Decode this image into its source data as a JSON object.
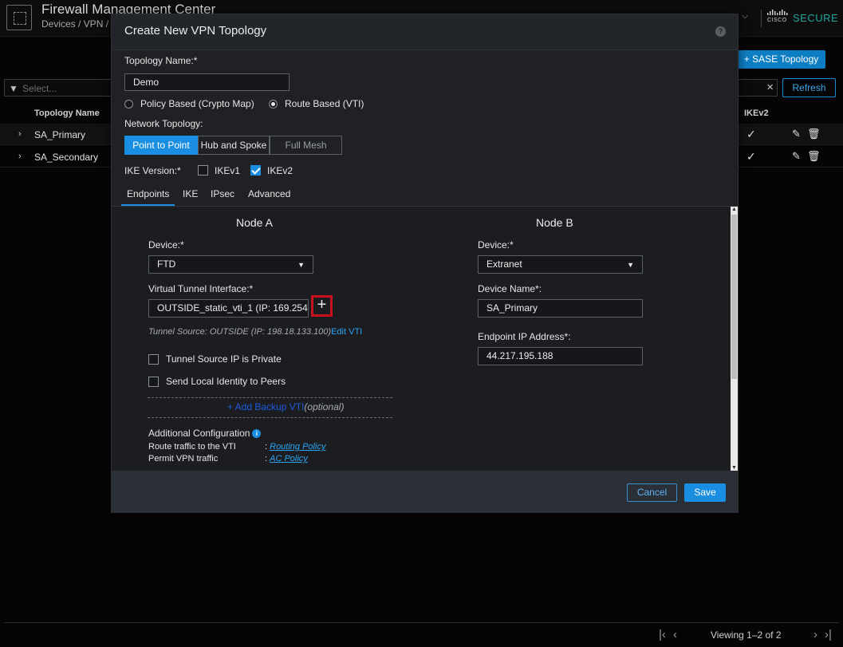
{
  "app": {
    "title": "Firewall Management Center",
    "breadcrumb": "Devices / VPN /",
    "cisco_text": "CISCO",
    "brand": "SECURE"
  },
  "background": {
    "sase_button": "+ SASE Topology",
    "filter_placeholder": "Select...",
    "refresh_button": "Refresh",
    "columns": {
      "name": "Topology Name",
      "ike": "IKEv2"
    },
    "rows": [
      {
        "name": "SA_Primary"
      },
      {
        "name": "SA_Secondary"
      }
    ],
    "pager_text": "Viewing 1–2 of 2"
  },
  "modal": {
    "title": "Create New VPN Topology",
    "topology_name_label": "Topology Name:*",
    "topology_name_value": "Demo",
    "policy_based_label": "Policy Based (Crypto Map)",
    "route_based_label": "Route Based (VTI)",
    "network_topology_label": "Network Topology:",
    "topology_options": [
      "Point to Point",
      "Hub and Spoke",
      "Full Mesh"
    ],
    "ike_version_label": "IKE Version:*",
    "ikev1_label": "IKEv1",
    "ikev2_label": "IKEv2",
    "tabs": [
      "Endpoints",
      "IKE",
      "IPsec",
      "Advanced"
    ],
    "node_a": {
      "title": "Node A",
      "device_label": "Device:*",
      "device_value": "FTD",
      "vti_label": "Virtual Tunnel Interface:*",
      "vti_value": "OUTSIDE_static_vti_1 (IP: 169.254",
      "tunnel_source": "Tunnel Source: OUTSIDE (IP: 198.18.133.100)",
      "edit_vti": "Edit VTI",
      "tunnel_private_label": "Tunnel Source IP is Private",
      "send_identity_label": "Send Local Identity to Peers",
      "add_backup": "+ Add Backup VTI",
      "optional": "(optional)",
      "additional_config": "Additional Configuration",
      "route_traffic_label": "Route traffic to the VTI",
      "routing_policy": "Routing Policy",
      "permit_vpn_label": "Permit VPN traffic",
      "ac_policy": "AC Policy",
      "colon": ":"
    },
    "node_b": {
      "title": "Node B",
      "device_label": "Device:*",
      "device_value": "Extranet",
      "device_name_label": "Device Name*:",
      "device_name_value": "SA_Primary",
      "endpoint_ip_label": "Endpoint IP Address*:",
      "endpoint_ip_value": "44.217.195.188"
    },
    "cancel": "Cancel",
    "save": "Save"
  },
  "colors": {
    "accent": "#1a8ee0",
    "highlight": "#c8101e",
    "brand": "#1fa7a0"
  }
}
